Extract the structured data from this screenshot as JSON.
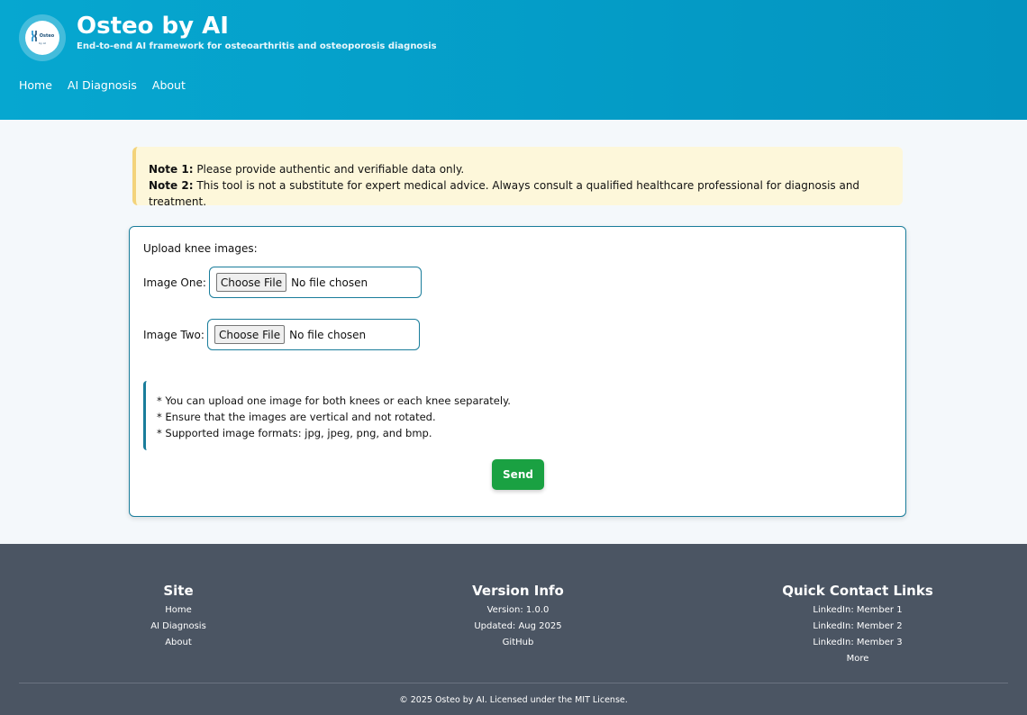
{
  "header": {
    "title": "Osteo by AI",
    "subtitle": "End-to-end AI framework for osteoarthritis and osteoporosis diagnosis",
    "logo_text": "Osteo",
    "logo_sub": "by AI",
    "nav": [
      "Home",
      "AI Diagnosis",
      "About"
    ]
  },
  "notes": {
    "note1_label": "Note 1:",
    "note1_text": " Please provide authentic and verifiable data only.",
    "note2_label": "Note 2:",
    "note2_text": " This tool is not a substitute for expert medical advice. Always consult a qualified healthcare professional for diagnosis and treatment."
  },
  "form": {
    "heading": "Upload knee images:",
    "image_one_label": "Image One:",
    "image_two_label": "Image Two:",
    "choose_file_label": "Choose File",
    "no_file_text": "No file chosen",
    "tips": [
      "* You can upload one image for both knees or each knee separately.",
      "* Ensure that the images are vertical and not rotated.",
      "* Supported image formats: jpg, jpeg, png, and bmp."
    ],
    "send_label": "Send"
  },
  "footer": {
    "site": {
      "heading": "Site",
      "links": [
        "Home",
        "AI Diagnosis",
        "About"
      ]
    },
    "version": {
      "heading": "Version Info",
      "items": [
        "Version: 1.0.0",
        "Updated: Aug 2025",
        "GitHub"
      ]
    },
    "contact": {
      "heading": "Quick Contact Links",
      "links": [
        "LinkedIn: Member 1",
        "LinkedIn: Member 2",
        "LinkedIn: Member 3",
        "More"
      ]
    },
    "copyright": "© 2025 Osteo by AI. Licensed under the MIT License."
  },
  "colors": {
    "header_bg": "#06a7d0",
    "accent": "#1a7d9b",
    "send_button": "#1aa142",
    "note_bg": "#fdf7da",
    "footer_bg": "#4b5563"
  },
  "icons": {
    "logo": "knee-joint-logo-icon"
  }
}
